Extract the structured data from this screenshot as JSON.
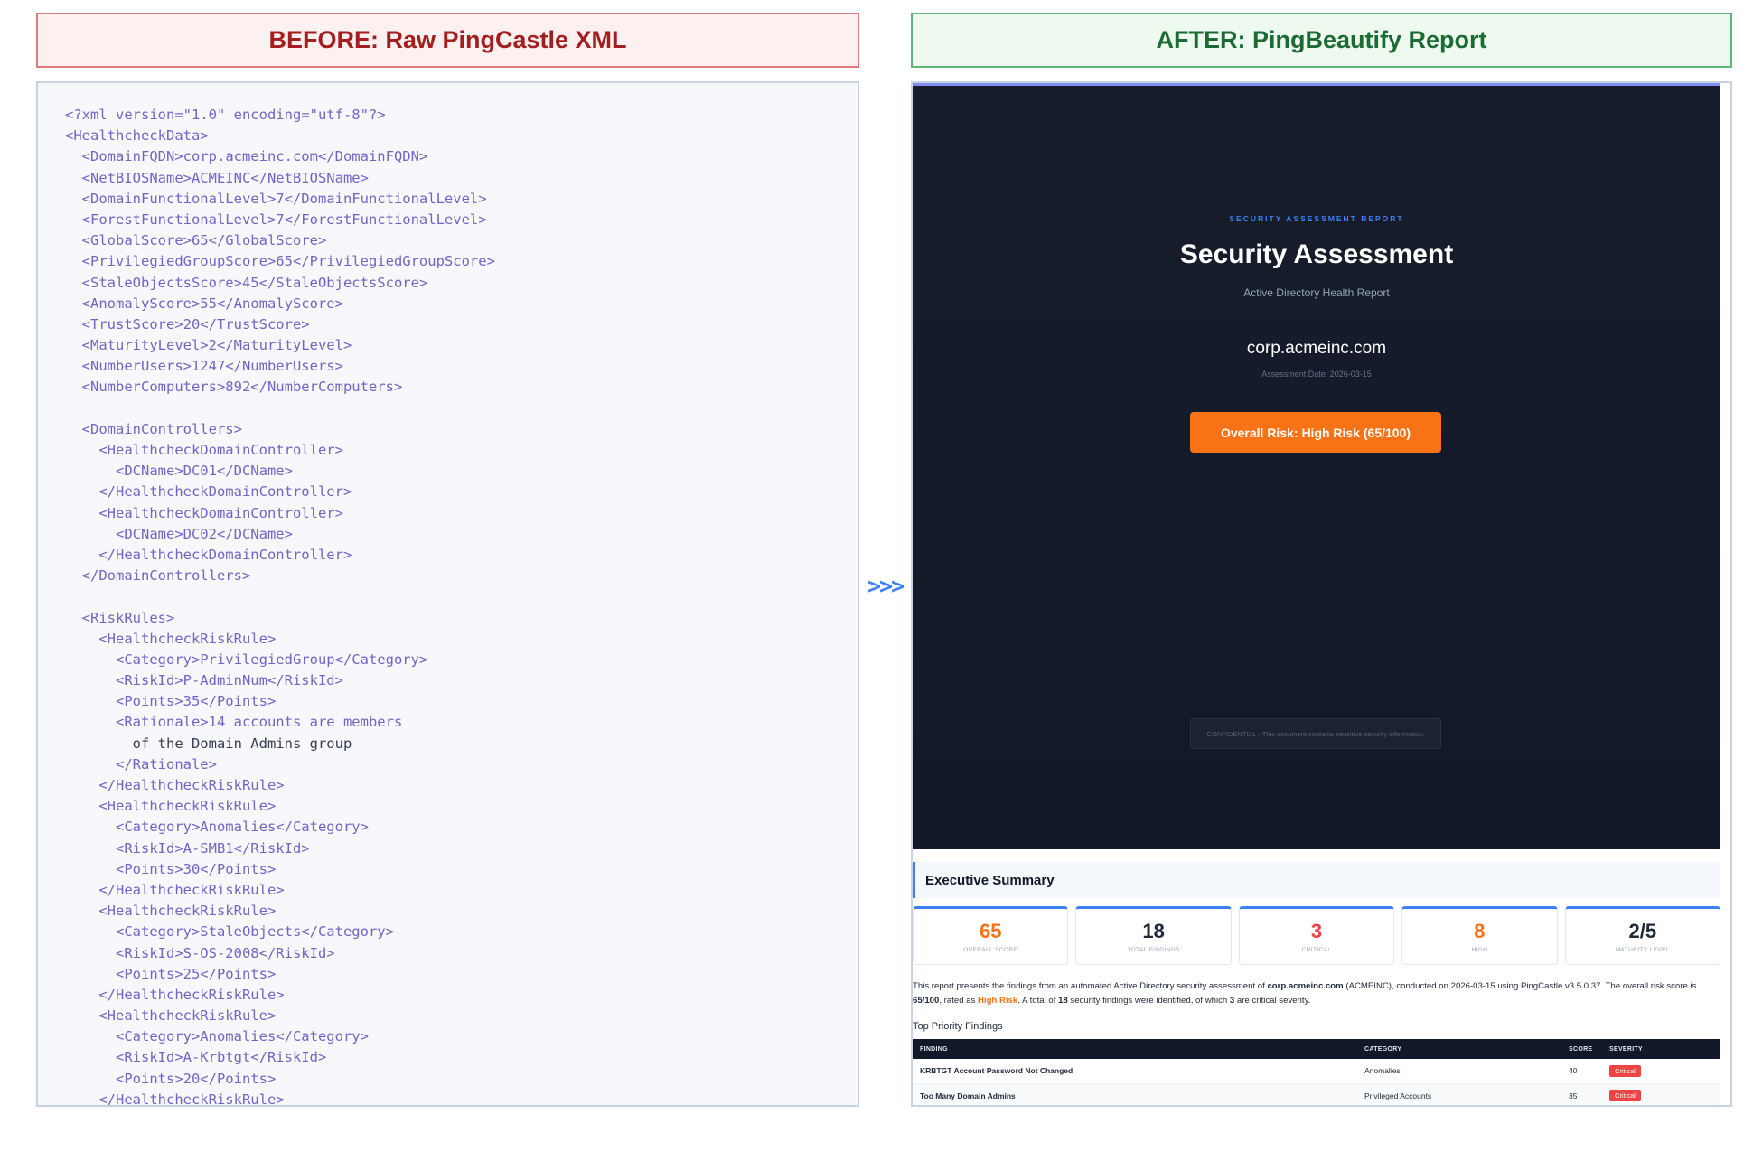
{
  "before_title": "BEFORE: Raw PingCastle XML",
  "after_title": "AFTER: PingBeautify Report",
  "arrow": ">>>",
  "xml_lines": [
    [
      {
        "t": "<?xml version=\"1.0\" encoding=\"utf-8\"?>",
        "c": "tag"
      }
    ],
    [
      {
        "t": "<HealthcheckData>",
        "c": "tag"
      }
    ],
    [
      {
        "t": "  <DomainFQDN>",
        "c": "tag"
      },
      {
        "t": "corp.acmeinc.com",
        "c": "tag"
      },
      {
        "t": "</DomainFQDN>",
        "c": "tag"
      }
    ],
    [
      {
        "t": "  <NetBIOSName>ACMEINC</NetBIOSName>",
        "c": "tag"
      }
    ],
    [
      {
        "t": "  <DomainFunctionalLevel>7</DomainFunctionalLevel>",
        "c": "tag"
      }
    ],
    [
      {
        "t": "  <ForestFunctionalLevel>7</ForestFunctionalLevel>",
        "c": "tag"
      }
    ],
    [
      {
        "t": "  <GlobalScore>65</GlobalScore>",
        "c": "tag"
      }
    ],
    [
      {
        "t": "  <PrivilegiedGroupScore>65</PrivilegiedGroupScore>",
        "c": "tag"
      }
    ],
    [
      {
        "t": "  <StaleObjectsScore>45</StaleObjectsScore>",
        "c": "tag"
      }
    ],
    [
      {
        "t": "  <AnomalyScore>55</AnomalyScore>",
        "c": "tag"
      }
    ],
    [
      {
        "t": "  <TrustScore>20</TrustScore>",
        "c": "tag"
      }
    ],
    [
      {
        "t": "  <MaturityLevel>2</MaturityLevel>",
        "c": "tag"
      }
    ],
    [
      {
        "t": "  <NumberUsers>1247</NumberUsers>",
        "c": "tag"
      }
    ],
    [
      {
        "t": "  <NumberComputers>892</NumberComputers>",
        "c": "tag"
      }
    ],
    [
      {
        "t": "",
        "c": "tag"
      }
    ],
    [
      {
        "t": "  <DomainControllers>",
        "c": "tag"
      }
    ],
    [
      {
        "t": "    <HealthcheckDomainController>",
        "c": "tag"
      }
    ],
    [
      {
        "t": "      <DCName>DC01</DCName>",
        "c": "tag"
      }
    ],
    [
      {
        "t": "    </HealthcheckDomainController>",
        "c": "tag"
      }
    ],
    [
      {
        "t": "    <HealthcheckDomainController>",
        "c": "tag"
      }
    ],
    [
      {
        "t": "      <DCName>DC02</DCName>",
        "c": "tag"
      }
    ],
    [
      {
        "t": "    </HealthcheckDomainController>",
        "c": "tag"
      }
    ],
    [
      {
        "t": "  </DomainControllers>",
        "c": "tag"
      }
    ],
    [
      {
        "t": "",
        "c": "tag"
      }
    ],
    [
      {
        "t": "  <RiskRules>",
        "c": "tag"
      }
    ],
    [
      {
        "t": "    <HealthcheckRiskRule>",
        "c": "tag"
      }
    ],
    [
      {
        "t": "      <Category>PrivilegiedGroup</Category>",
        "c": "tag"
      }
    ],
    [
      {
        "t": "      <RiskId>P-AdminNum</RiskId>",
        "c": "tag"
      }
    ],
    [
      {
        "t": "      <Points>35</Points>",
        "c": "tag"
      }
    ],
    [
      {
        "t": "      <Rationale>14 accounts are members",
        "c": "tag"
      }
    ],
    [
      {
        "t": "        of the Domain Admins group",
        "c": "txt"
      }
    ],
    [
      {
        "t": "      </Rationale>",
        "c": "tag"
      }
    ],
    [
      {
        "t": "    </HealthcheckRiskRule>",
        "c": "tag"
      }
    ],
    [
      {
        "t": "    <HealthcheckRiskRule>",
        "c": "tag"
      }
    ],
    [
      {
        "t": "      <Category>Anomalies</Category>",
        "c": "tag"
      }
    ],
    [
      {
        "t": "      <RiskId>A-SMB1</RiskId>",
        "c": "tag"
      }
    ],
    [
      {
        "t": "      <Points>30</Points>",
        "c": "tag"
      }
    ],
    [
      {
        "t": "    </HealthcheckRiskRule>",
        "c": "tag"
      }
    ],
    [
      {
        "t": "    <HealthcheckRiskRule>",
        "c": "tag"
      }
    ],
    [
      {
        "t": "      <Category>StaleObjects</Category>",
        "c": "tag"
      }
    ],
    [
      {
        "t": "      <RiskId>S-OS-2008</RiskId>",
        "c": "tag"
      }
    ],
    [
      {
        "t": "      <Points>25</Points>",
        "c": "tag"
      }
    ],
    [
      {
        "t": "    </HealthcheckRiskRule>",
        "c": "tag"
      }
    ],
    [
      {
        "t": "    <HealthcheckRiskRule>",
        "c": "tag"
      }
    ],
    [
      {
        "t": "      <Category>Anomalies</Category>",
        "c": "tag"
      }
    ],
    [
      {
        "t": "      <RiskId>A-Krbtgt</RiskId>",
        "c": "tag"
      }
    ],
    [
      {
        "t": "      <Points>20</Points>",
        "c": "tag"
      }
    ],
    [
      {
        "t": "    </HealthcheckRiskRule>",
        "c": "tag"
      }
    ]
  ],
  "report": {
    "kicker": "SECURITY ASSESSMENT REPORT",
    "title": "Security Assessment",
    "subtitle": "Active Directory Health Report",
    "domain": "corp.acmeinc.com",
    "date": "Assessment Date: 2026-03-15",
    "risk_button": "Overall Risk: High Risk (65/100)",
    "confidential": "CONFIDENTIAL - This document contains sensitive security information.",
    "exec_title": "Executive Summary",
    "cards": [
      {
        "value": "65",
        "label": "OVERALL SCORE",
        "color": "#f97316"
      },
      {
        "value": "18",
        "label": "TOTAL FINDINGS",
        "color": "#1f2937"
      },
      {
        "value": "3",
        "label": "CRITICAL",
        "color": "#ef4444"
      },
      {
        "value": "8",
        "label": "HIGH",
        "color": "#f97316"
      },
      {
        "value": "2/5",
        "label": "MATURITY LEVEL",
        "color": "#1f2937"
      }
    ],
    "summary": {
      "p1": "This report presents the findings from an automated Active Directory security assessment of ",
      "domain": "corp.acmeinc.com",
      "p2": " (ACMEINC), conducted on 2026-03-15 using PingCastle v3.5.0.37. The overall risk score is ",
      "score": "65/100",
      "p3": ", rated as ",
      "rating": "High Risk",
      "p4": ". A total of ",
      "total": "18",
      "p5": " security findings were identified, of which ",
      "critical": "3",
      "p6": " are critical severity."
    },
    "top_priority_title": "Top Priority Findings",
    "table_headers": [
      "FINDING",
      "CATEGORY",
      "SCORE",
      "SEVERITY"
    ],
    "table_rows": [
      {
        "finding": "KRBTGT Account Password Not Changed",
        "category": "Anomalies",
        "score": "40",
        "severity": "Critical"
      },
      {
        "finding": "Too Many Domain Admins",
        "category": "Privileged Accounts",
        "score": "35",
        "severity": "Critical"
      }
    ]
  }
}
